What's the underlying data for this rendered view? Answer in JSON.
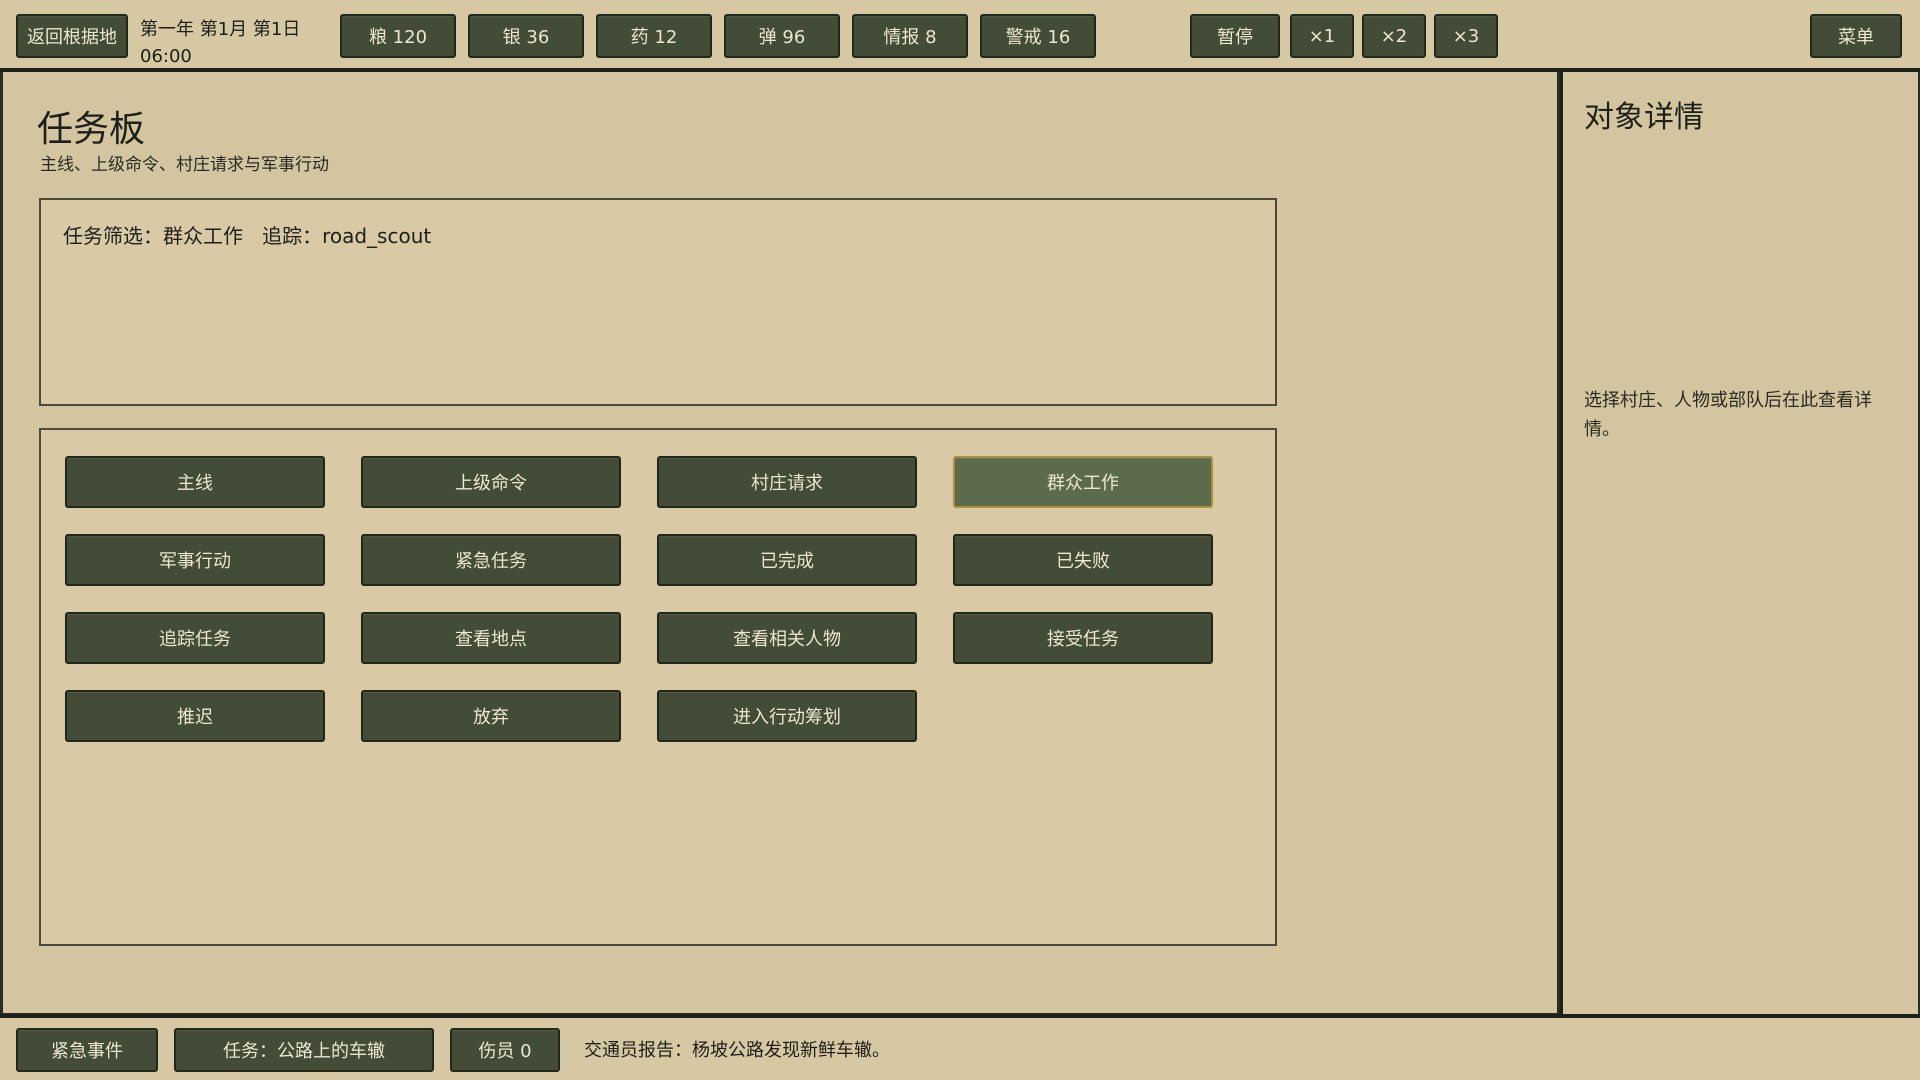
{
  "topbar": {
    "back_label": "返回根据地",
    "date": "第一年 第1月 第1日",
    "time": "06:00",
    "resources": [
      {
        "label": "粮 120"
      },
      {
        "label": "银 36"
      },
      {
        "label": "药 12"
      },
      {
        "label": "弹 96"
      },
      {
        "label": "情报 8"
      },
      {
        "label": "警戒 16"
      }
    ],
    "pause_label": "暂停",
    "speeds": [
      "×1",
      "×2",
      "×3"
    ],
    "menu_label": "菜单"
  },
  "main": {
    "title": "任务板",
    "subtitle": "主线、上级命令、村庄请求与军事行动",
    "info_line": "任务筛选：群众工作   追踪：road_scout",
    "buttons": [
      {
        "label": "主线"
      },
      {
        "label": "上级命令"
      },
      {
        "label": "村庄请求"
      },
      {
        "label": "群众工作",
        "active": true
      },
      {
        "label": "军事行动"
      },
      {
        "label": "紧急任务"
      },
      {
        "label": "已完成"
      },
      {
        "label": "已失败"
      },
      {
        "label": "追踪任务"
      },
      {
        "label": "查看地点"
      },
      {
        "label": "查看相关人物"
      },
      {
        "label": "接受任务"
      },
      {
        "label": "推迟"
      },
      {
        "label": "放弃"
      },
      {
        "label": "进入行动筹划"
      }
    ]
  },
  "detail": {
    "title": "对象详情",
    "hint": "选择村庄、人物或部队后在此查看详情。"
  },
  "bottombar": {
    "emergency_label": "紧急事件",
    "task_label": "任务：公路上的车辙",
    "casualty_label": "伤员 0",
    "report": "交通员报告：杨坡公路发现新鲜车辙。"
  },
  "colors": {
    "button_bg": "#424c36",
    "button_active_bg": "#5b6b4b",
    "button_active_border": "#a88e3e",
    "panel_bg": "#d9c9a5",
    "page_bg": "#d3c5a0"
  }
}
